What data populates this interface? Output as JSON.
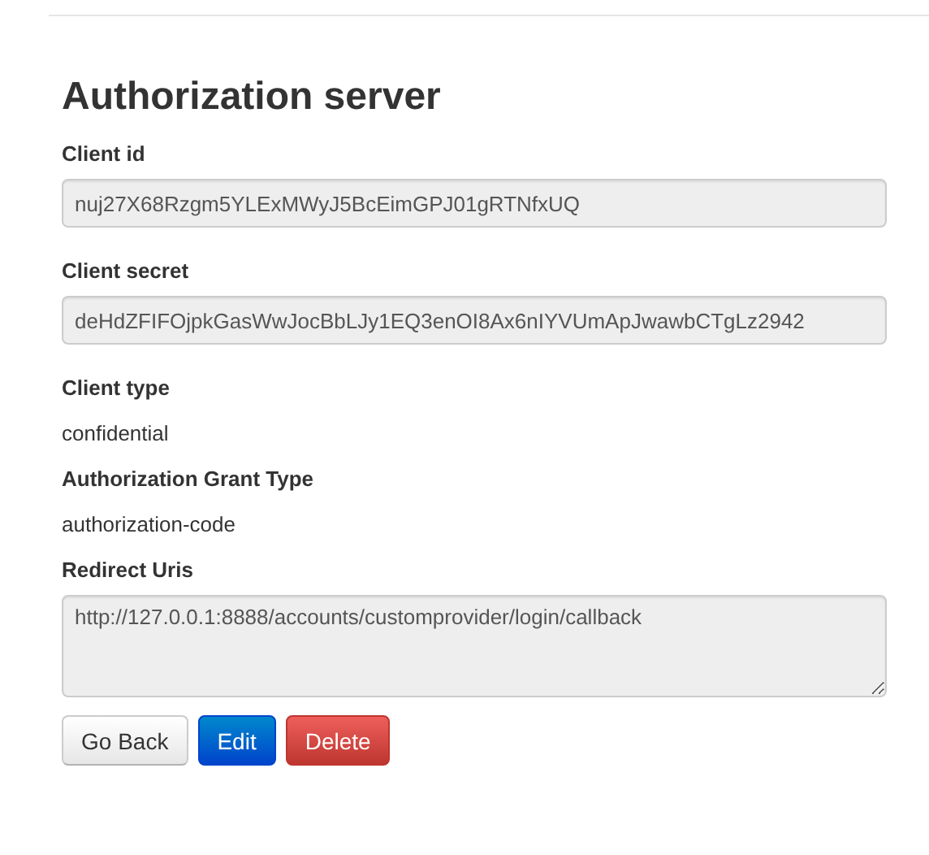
{
  "title": "Authorization server",
  "fields": [
    {
      "kind": "input",
      "label": "Client id",
      "value": "nuj27X68Rzgm5YLExMWyJ5BcEimGPJ01gRTNfxUQ"
    },
    {
      "kind": "input",
      "label": "Client secret",
      "value": "deHdZFIFOjpkGasWwJocBbLJy1EQ3enOI8Ax6nIYVUmApJwawbCTgLz2942"
    },
    {
      "kind": "text",
      "label": "Client type",
      "value": "confidential"
    },
    {
      "kind": "text",
      "label": "Authorization Grant Type",
      "value": "authorization-code"
    },
    {
      "kind": "textarea",
      "label": "Redirect Uris",
      "value": "http://127.0.0.1:8888/accounts/customprovider/login/callback"
    }
  ],
  "buttons": [
    {
      "kind": "default",
      "label": "Go Back"
    },
    {
      "kind": "primary",
      "label": "Edit"
    },
    {
      "kind": "danger",
      "label": "Delete"
    }
  ]
}
